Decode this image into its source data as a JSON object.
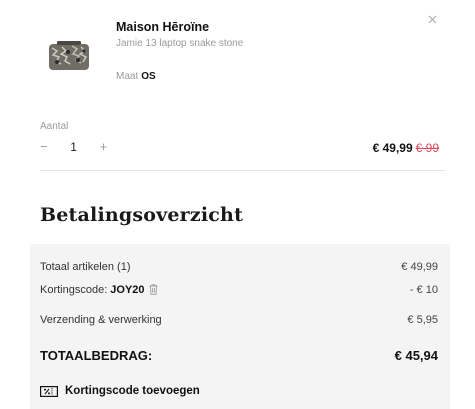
{
  "product": {
    "brand": "Maison Hēroïne",
    "variant": "Jamie 13 laptop snake stone",
    "size_label": "Maat",
    "size_value": "OS"
  },
  "quantity": {
    "label": "Aantal",
    "minus": "−",
    "value": "1",
    "plus": "+"
  },
  "price": {
    "current": "€ 49,99",
    "original": "€ 99"
  },
  "summary": {
    "title": "Betalingsoverzicht",
    "items_label": "Totaal artikelen (1)",
    "items_value": "€ 49,99",
    "discount_label": "Kortingscode:",
    "discount_code": "JOY20",
    "discount_value": "- € 10",
    "shipping_label": "Verzending & verwerking",
    "shipping_value": "€ 5,95",
    "total_label": "TOTAALBEDRAG:",
    "total_value": "€ 45,94",
    "add_coupon_label": "Kortingscode toevoegen"
  },
  "icons": {
    "close": "close-icon",
    "trash": "trash-icon",
    "coupon": "coupon-icon"
  }
}
